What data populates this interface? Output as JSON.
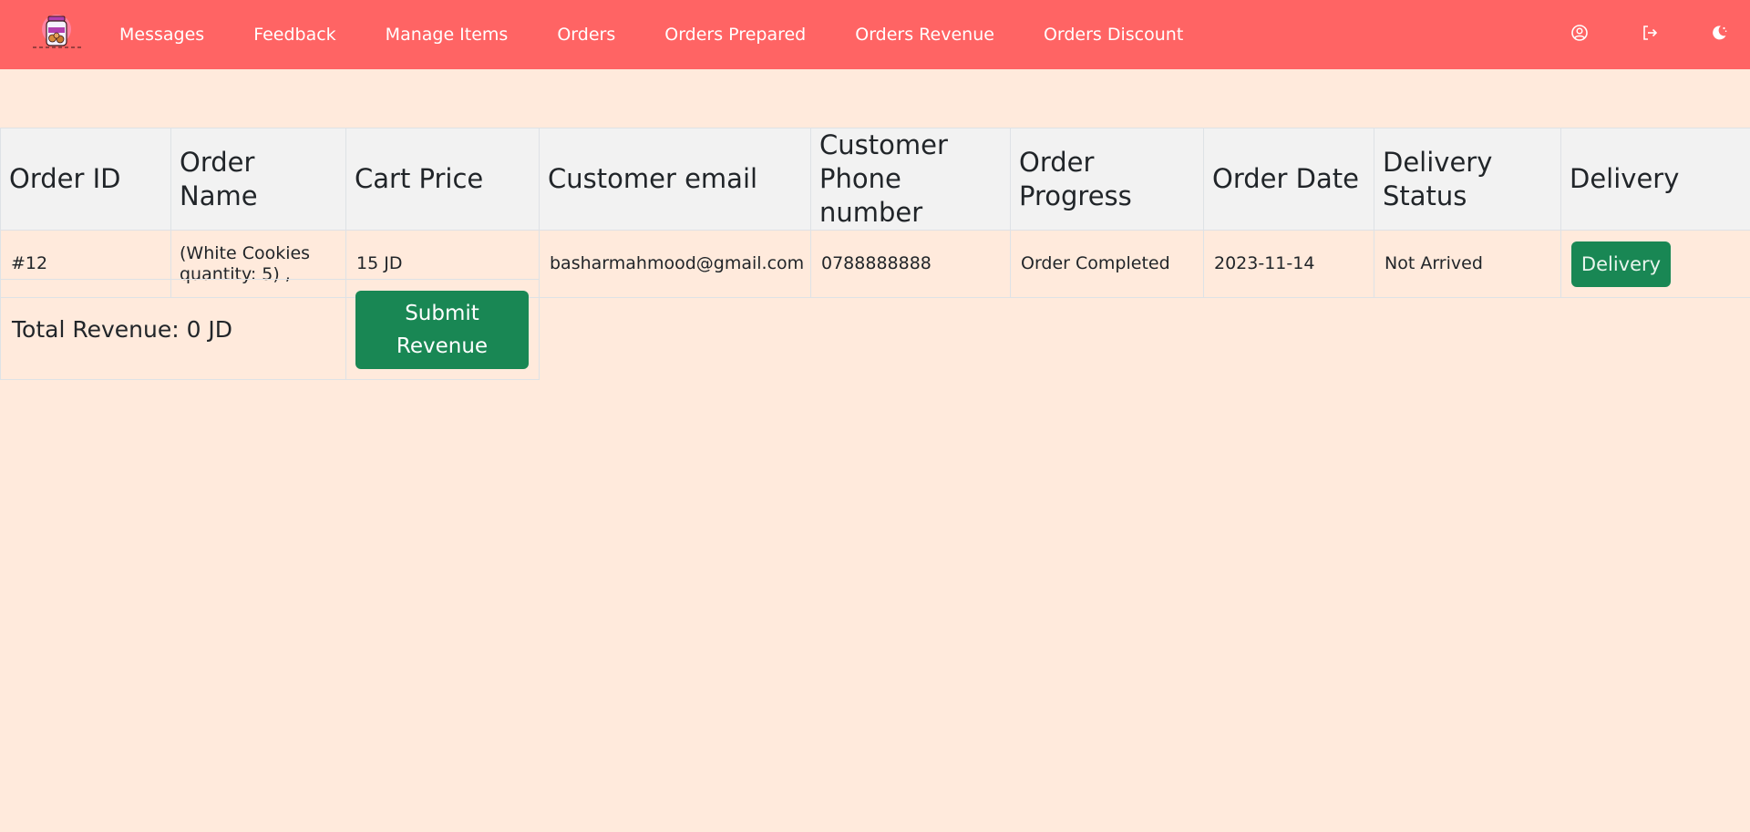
{
  "brand": {
    "logo_icon": "cookie-jar-logo",
    "colors": {
      "navbar": "#ff6464",
      "page_background": "#ffeadc",
      "button": "#198754"
    }
  },
  "nav": {
    "links": [
      {
        "label": "Messages"
      },
      {
        "label": "Feedback"
      },
      {
        "label": "Manage Items"
      },
      {
        "label": "Orders"
      },
      {
        "label": "Orders Prepared"
      },
      {
        "label": "Orders Revenue"
      },
      {
        "label": "Orders Discount"
      }
    ],
    "icons": [
      "user-circle-icon",
      "logout-icon",
      "dark-mode-icon"
    ]
  },
  "table": {
    "headers": [
      "Order ID",
      "Order Name",
      "Cart Price",
      "Customer email",
      "Customer Phone number",
      "Order Progress",
      "Order Date",
      "Delivery Status",
      "Delivery"
    ],
    "rows": [
      {
        "order_id": "#12",
        "order_name": "(White Cookies quantity: 5) ,",
        "cart_price": "15 JD",
        "customer_email": "basharmahmood@gmail.com",
        "customer_phone": "0788888888",
        "order_progress": "Order Completed",
        "order_date": "2023-11-14",
        "delivery_status": "Not Arrived",
        "delivery_button": "Delivery"
      }
    ]
  },
  "revenue": {
    "total_label": "Total Revenue: 0 JD",
    "submit_label": "Submit Revenue"
  }
}
